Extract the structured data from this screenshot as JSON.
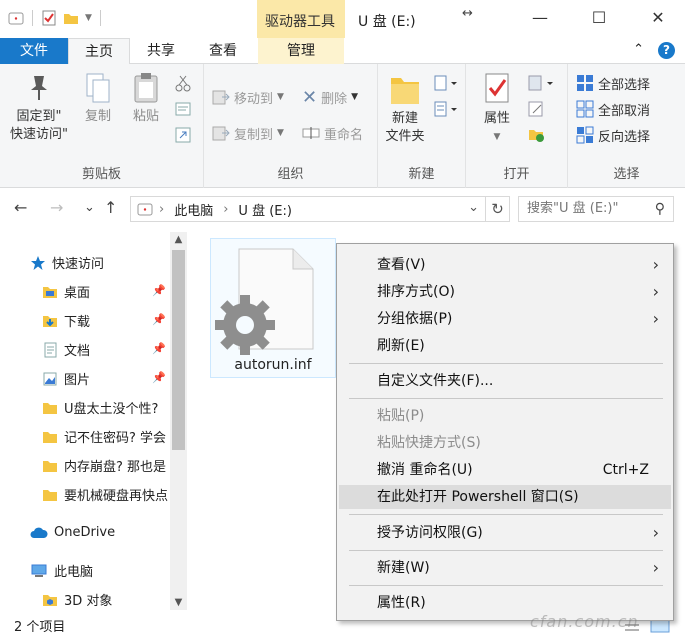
{
  "window": {
    "title": "U 盘 (E:)",
    "context_tab_head": "驱动器工具",
    "minimize": "—",
    "maximize": "☐",
    "close": "✕"
  },
  "tabs": {
    "file": "文件",
    "home": "主页",
    "share": "共享",
    "view": "查看",
    "manage": "管理",
    "collapse": "⌃",
    "help": "?"
  },
  "ribbon": {
    "clipboard": {
      "label": "剪贴板",
      "pin_line1": "固定到\"",
      "pin_line2": "快速访问\"",
      "copy": "复制",
      "paste": "粘贴"
    },
    "organize": {
      "label": "组织",
      "move_to": "移动到",
      "copy_to": "复制到",
      "delete": "删除",
      "rename": "重命名"
    },
    "new": {
      "label": "新建",
      "new_folder_line1": "新建",
      "new_folder_line2": "文件夹"
    },
    "open": {
      "label": "打开",
      "properties": "属性"
    },
    "select": {
      "label": "选择",
      "select_all": "全部选择",
      "select_none": "全部取消",
      "invert": "反向选择"
    }
  },
  "nav": {
    "back": "←",
    "forward": "→",
    "recent": "⌄",
    "up": "↑",
    "path": [
      "此电脑",
      "U 盘 (E:)"
    ],
    "path_sep": "›",
    "dropdown": "⌄",
    "refresh": "↻",
    "search_placeholder": "搜索\"U 盘 (E:)\"",
    "search_icon": "⚲"
  },
  "sidebar": {
    "quick_access": "快速访问",
    "items": [
      {
        "label": "桌面",
        "pinned": true
      },
      {
        "label": "下载",
        "pinned": true
      },
      {
        "label": "文档",
        "pinned": true
      },
      {
        "label": "图片",
        "pinned": true
      },
      {
        "label": "U盘太土没个性?",
        "pinned": false
      },
      {
        "label": "记不住密码? 学会",
        "pinned": false
      },
      {
        "label": "内存崩盘? 那也是",
        "pinned": false
      },
      {
        "label": "要机械硬盘再快点",
        "pinned": false
      }
    ],
    "onedrive": "OneDrive",
    "this_pc": "此电脑",
    "objects3d": "3D 对象"
  },
  "content": {
    "file_name": "autorun.inf"
  },
  "status": {
    "count": "2 个项目"
  },
  "context_menu": {
    "items": [
      {
        "label": "查看(V)",
        "submenu": true,
        "disabled": false
      },
      {
        "label": "排序方式(O)",
        "submenu": true,
        "disabled": false
      },
      {
        "label": "分组依据(P)",
        "submenu": true,
        "disabled": false
      },
      {
        "label": "刷新(E)",
        "submenu": false,
        "disabled": false
      },
      {
        "label": "自定义文件夹(F)...",
        "submenu": false,
        "disabled": false
      },
      {
        "label": "粘贴(P)",
        "submenu": false,
        "disabled": true
      },
      {
        "label": "粘贴快捷方式(S)",
        "submenu": false,
        "disabled": true
      },
      {
        "label": "撤消 重命名(U)",
        "shortcut": "Ctrl+Z",
        "submenu": false,
        "disabled": false
      },
      {
        "label": "在此处打开 Powershell 窗口(S)",
        "submenu": false,
        "disabled": false,
        "highlighted": true
      },
      {
        "label": "授予访问权限(G)",
        "submenu": true,
        "disabled": false
      },
      {
        "label": "新建(W)",
        "submenu": true,
        "disabled": false
      },
      {
        "label": "属性(R)",
        "submenu": false,
        "disabled": false
      }
    ],
    "submenu_arrow": "›"
  },
  "colors": {
    "accent": "#1979ca",
    "context_tab": "#fbe8a8",
    "menu_bg": "#f2f2f2",
    "menu_highlight": "#dcdcdc"
  },
  "watermark": "cfan.com.cn"
}
